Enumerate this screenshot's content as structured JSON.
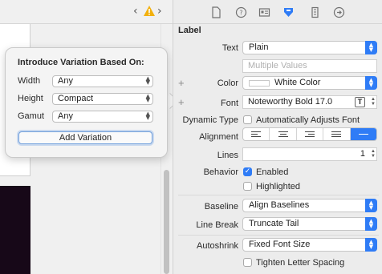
{
  "popover": {
    "title": "Introduce Variation Based On:",
    "rows": [
      {
        "label": "Width",
        "value": "Any"
      },
      {
        "label": "Height",
        "value": "Compact"
      },
      {
        "label": "Gamut",
        "value": "Any"
      }
    ],
    "add_button": "Add Variation"
  },
  "inspector": {
    "section_title": "Label",
    "text": {
      "label": "Text",
      "value": "Plain"
    },
    "multiple_values_placeholder": "Multiple Values",
    "color": {
      "label": "Color",
      "value": "White Color"
    },
    "font": {
      "label": "Font",
      "value": "Noteworthy Bold 17.0",
      "button_glyph": "T"
    },
    "dynamic_type": {
      "label": "Dynamic Type",
      "checkbox_label": "Automatically Adjusts Font",
      "checked": false
    },
    "alignment": {
      "label": "Alignment",
      "selected_index": 4
    },
    "lines": {
      "label": "Lines",
      "value": "1"
    },
    "behavior": {
      "label": "Behavior",
      "enabled_label": "Enabled",
      "enabled_checked": true,
      "highlighted_label": "Highlighted",
      "highlighted_checked": false
    },
    "baseline": {
      "label": "Baseline",
      "value": "Align Baselines"
    },
    "line_break": {
      "label": "Line Break",
      "value": "Truncate Tail"
    },
    "autoshrink": {
      "label": "Autoshrink",
      "value": "Fixed Font Size"
    },
    "tighten": {
      "checkbox_label": "Tighten Letter Spacing",
      "checked": false
    }
  },
  "colors": {
    "accent": "#2f7cf6",
    "warning": "#f2b00d",
    "dark_canvas": "#170818"
  },
  "toolbar_icons": [
    "file-icon",
    "help-icon",
    "identity-icon",
    "attributes-icon",
    "size-icon",
    "connections-icon"
  ],
  "plus_glyph": "+"
}
